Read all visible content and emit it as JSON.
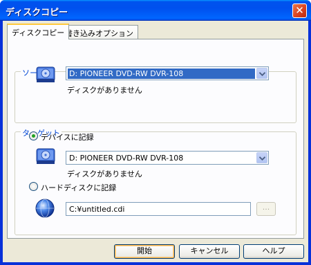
{
  "window": {
    "title": "ディスクコピー",
    "close_label": "✕"
  },
  "tabs": [
    {
      "label": "ディスクコピー",
      "active": true
    },
    {
      "label": "書き込みオプション",
      "active": false
    }
  ],
  "source": {
    "caption": "ソース",
    "drive_value": "D: PIONEER  DVD-RW   DVR-108",
    "status": "ディスクがありません"
  },
  "target": {
    "caption": "ターゲット",
    "device_option": {
      "label": "デバイスに記録",
      "checked": true
    },
    "drive_value": "D: PIONEER  DVD-RW   DVR-108",
    "status": "ディスクがありません",
    "hdd_option": {
      "label": "ハードディスクに記録",
      "checked": false
    },
    "file_path": "C:¥untitled.cdi",
    "browse_label": "..."
  },
  "buttons": {
    "start": "開始",
    "cancel": "キャンセル",
    "help": "ヘルプ"
  },
  "icons": {
    "drive": "drive-icon",
    "globe": "globe-icon",
    "dropdown": "chevron-down-icon"
  },
  "colors": {
    "accent": "#0046d5",
    "selection": "#316ac5",
    "title_bar": "#0054e3"
  }
}
